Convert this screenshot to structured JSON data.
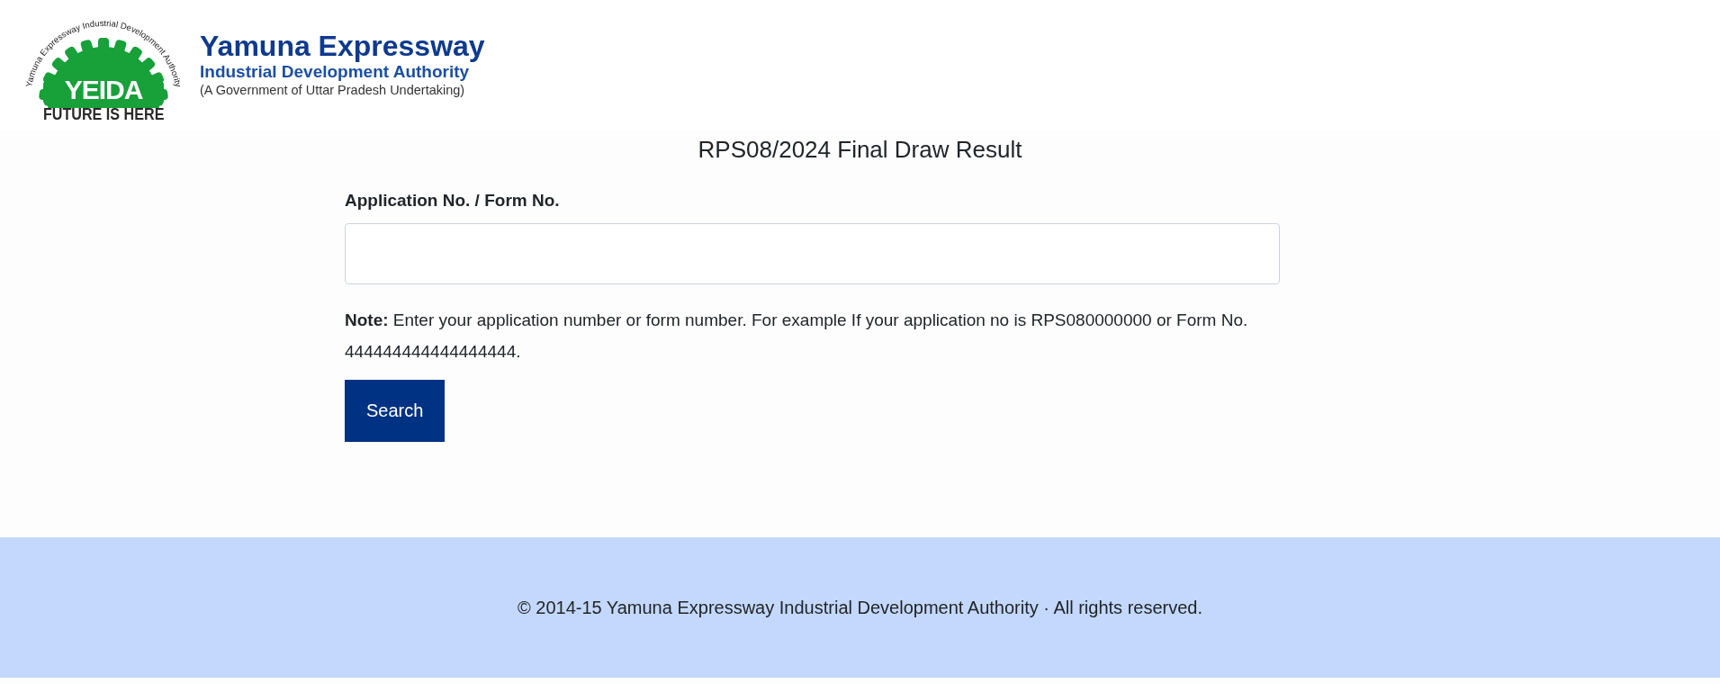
{
  "header": {
    "logo": {
      "arc_text": "Yamuna Expressway Industrial Development Authority",
      "emblem_text": "YEIDA",
      "tagline": "FUTURE IS HERE",
      "name": "Yamuna Expressway",
      "subtitle": "Industrial Development Authority",
      "note": "(A Government of Uttar Pradesh Undertaking)"
    }
  },
  "page_title": "RPS08/2024 Final Draw Result",
  "form": {
    "label": "Application No. / Form No.",
    "note": "**Note:** Enter your application number or form number. For example If your application no is RPS080000000 or Form No. 444444444444444444.",
    "button": "Search"
  },
  "footer": {
    "text": "© 2014-15 Yamuna Expressway Industrial Development Authority · All rights reserved."
  }
}
